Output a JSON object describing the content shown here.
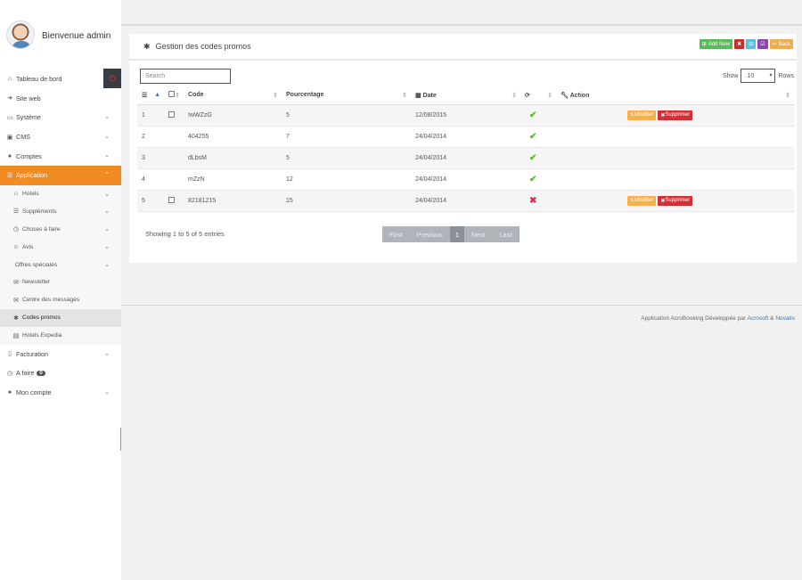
{
  "user": {
    "welcome": "Bienvenue admin"
  },
  "sidebar": {
    "items": [
      {
        "label": "Tableau de bord",
        "icon": "home-icon",
        "glyph": "⌂"
      },
      {
        "label": "Site web",
        "icon": "sign-in-icon",
        "glyph": "➜"
      },
      {
        "label": "Système",
        "icon": "laptop-icon",
        "glyph": "▭"
      },
      {
        "label": "CMS",
        "icon": "desktop-icon",
        "glyph": "▣"
      },
      {
        "label": "Comptes",
        "icon": "user-icon",
        "glyph": "●"
      },
      {
        "label": "Application",
        "icon": "list-icon",
        "glyph": "☰"
      }
    ],
    "subitems": [
      {
        "label": "Hotels",
        "icon": "home-icon",
        "glyph": "⌂"
      },
      {
        "label": "Suppléments",
        "icon": "list-icon",
        "glyph": "☰"
      },
      {
        "label": "Choses à faire",
        "icon": "clock-icon",
        "glyph": "◷"
      },
      {
        "label": "Avis",
        "icon": "smile-icon",
        "glyph": "☺"
      },
      {
        "label": "Offres spéciales",
        "icon": "",
        "glyph": ""
      },
      {
        "label": "Newsletter",
        "icon": "envelope-icon",
        "glyph": "✉"
      },
      {
        "label": "Centre des messages",
        "icon": "envelope-icon",
        "glyph": "✉"
      },
      {
        "label": "Codes promos",
        "icon": "asterisk-icon",
        "glyph": "✱"
      },
      {
        "label": "Hotels Expedia",
        "icon": "building-icon",
        "glyph": "▤"
      }
    ],
    "bottom": [
      {
        "label": "Facturation",
        "icon": "file-icon",
        "glyph": "▯"
      },
      {
        "label": "A faire",
        "icon": "clock-icon",
        "glyph": "◷",
        "badge": "0"
      },
      {
        "label": "Mon compte",
        "icon": "user-icon",
        "glyph": "●"
      }
    ]
  },
  "panel": {
    "title": "Gestion des codes promos",
    "add_new": "Add New",
    "back": "Back",
    "search_placeholder": "Search",
    "show_label": "Show",
    "rows_value": "10",
    "rows_label": "Rows"
  },
  "table": {
    "headers": {
      "code": "Code",
      "percent": "Pourcentage",
      "date": "Date",
      "action": "Action"
    },
    "rows": [
      {
        "num": "1",
        "code": "IwWZzG",
        "percent": "5",
        "date": "12/08/2015",
        "status": "ok",
        "actions": true
      },
      {
        "num": "2",
        "code": "404255",
        "percent": "7",
        "date": "24/04/2014",
        "status": "ok",
        "actions": false
      },
      {
        "num": "3",
        "code": "dLbsM",
        "percent": "5",
        "date": "24/04/2014",
        "status": "ok",
        "actions": false
      },
      {
        "num": "4",
        "code": "mZzN",
        "percent": "12",
        "date": "24/04/2014",
        "status": "ok",
        "actions": false
      },
      {
        "num": "5",
        "code": "82181215",
        "percent": "15",
        "date": "24/04/2014",
        "status": "no",
        "actions": true
      }
    ],
    "modify_label": "Modifier",
    "delete_label": "Supprimer"
  },
  "info": "Showing 1 to 5 of 5 entries",
  "pager": {
    "first": "First",
    "previous": "Previous",
    "current": "1",
    "next": "Next",
    "last": "Last"
  },
  "footer": {
    "text": "Application AcroBooking Développée par ",
    "link1": "Acrosoft",
    "amp": " & ",
    "link2": "Novatis"
  },
  "colors": {
    "accent": "#f28b23",
    "add": "#5cb85c",
    "delete": "#d03034",
    "modify": "#f5b14c",
    "ok": "#5cb72a",
    "no": "#e02c4c"
  }
}
